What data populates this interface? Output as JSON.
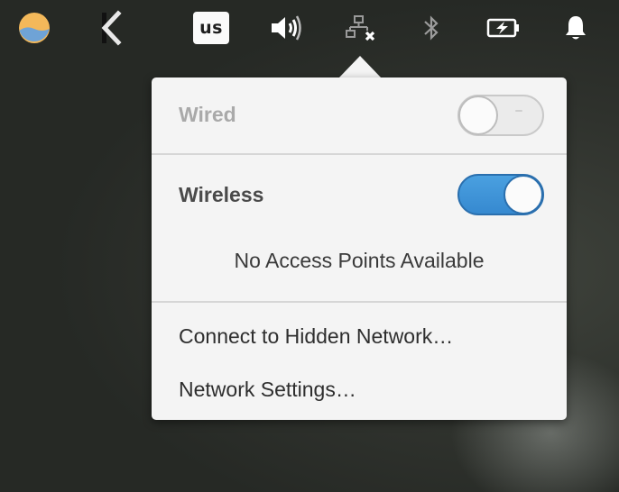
{
  "panel": {
    "icons": [
      {
        "name": "weather-icon"
      },
      {
        "name": "back-icon"
      },
      {
        "name": "keyboard-layout",
        "label": "us"
      },
      {
        "name": "volume-icon"
      },
      {
        "name": "network-disconnected-icon"
      },
      {
        "name": "bluetooth-icon"
      },
      {
        "name": "battery-charging-icon"
      },
      {
        "name": "notifications-icon"
      }
    ],
    "keyboard_label": "us"
  },
  "network_menu": {
    "wired": {
      "label": "Wired",
      "enabled": false
    },
    "wireless": {
      "label": "Wireless",
      "enabled": true
    },
    "status_text": "No Access Points Available",
    "items": [
      {
        "label": "Connect to Hidden Network…"
      },
      {
        "label": "Network Settings…"
      }
    ]
  },
  "colors": {
    "accent": "#3a8ed5",
    "popover_bg": "#f4f4f4",
    "panel_icon": "#ffffff"
  }
}
